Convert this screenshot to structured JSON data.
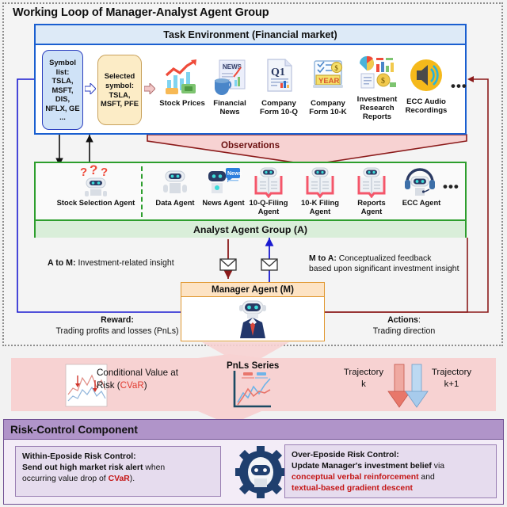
{
  "loop": {
    "title": "Working Loop of Manager-Analyst Agent Group",
    "observations_label": "Observations"
  },
  "environment": {
    "header": "Task Environment (Financial market)",
    "symbol_list": "Symbol list: TSLA, MSFT, DIS, NFLX, GE ...",
    "selected_symbol": "Selected symbol: TSLA, MSFT, PFE",
    "sources": [
      {
        "name": "stock-prices",
        "label": "Stock Prices"
      },
      {
        "name": "financial-news",
        "label": "Financial News"
      },
      {
        "name": "company-form-10q",
        "label": "Company Form 10-Q"
      },
      {
        "name": "company-form-10k",
        "label": "Company Form 10-K"
      },
      {
        "name": "investment-research-reports",
        "label": "Investment Research Reports"
      },
      {
        "name": "ecc-audio-recordings",
        "label": "ECC Audio Recordings"
      }
    ],
    "ellipsis": "•••"
  },
  "analyst_group": {
    "footer": "Analyst Agent Group (A)",
    "selection_agent": "Stock Selection Agent",
    "agents": [
      {
        "name": "data-agent",
        "label": "Data Agent"
      },
      {
        "name": "news-agent",
        "label": "News Agent"
      },
      {
        "name": "10q-filing-agent",
        "label": "10-Q-Filing Agent"
      },
      {
        "name": "10k-filing-agent",
        "label": "10-K Filing Agent"
      },
      {
        "name": "reports-agent",
        "label": "Reports Agent"
      },
      {
        "name": "ecc-agent",
        "label": "ECC Agent"
      }
    ],
    "ellipsis": "•••"
  },
  "manager": {
    "header": "Manager Agent (M)",
    "a_to_m_bold": "A to M:",
    "a_to_m_rest": "Investment-related  insight",
    "m_to_a_bold": "M to A:",
    "m_to_a_line1": "Conceptualized feedback",
    "m_to_a_line2": "based upon significant investment insight",
    "reward_title": "Reward:",
    "reward_text": "Trading profits and losses (PnLs)",
    "actions_title": "Actions",
    "actions_colon": ":",
    "actions_text": "Trading direction"
  },
  "pnl_band": {
    "cvar_line1": "Conditional Value at",
    "cvar_line2_prefix": "Risk (",
    "cvar_term": "CVaR",
    "cvar_line2_suffix": ")",
    "pnls_title": "PnLs Series",
    "trajectory_k_line1": "Trajectory",
    "trajectory_k_line2": "k",
    "trajectory_k1_line1": "Trajectory",
    "trajectory_k1_line2": "k+1"
  },
  "risk_control": {
    "header": "Risk-Control Component",
    "within": {
      "title": "Within-Eposide Risk Control:",
      "bold": "Send out high market risk alert",
      "mid": " when",
      "line2_prefix": "occurring value drop of ",
      "term": "CVaR",
      "line2_suffix": ")."
    },
    "over": {
      "title": "Over-Eposide Risk Control:",
      "bold": "Update Manager's investment belief",
      "via": " via",
      "red1": "conceptual verbal reinforcement",
      "and": " and",
      "red2": "textual-based gradient descent"
    }
  },
  "colors": {
    "env_border": "#1a5fd0",
    "analyst_border": "#2d9e2d",
    "manager_border": "#e0972f",
    "observation_red": "#8b1a1a",
    "reward_blue": "#1a1ad0",
    "risk_purple": "#6f4f92",
    "accent_red": "#c41616"
  }
}
